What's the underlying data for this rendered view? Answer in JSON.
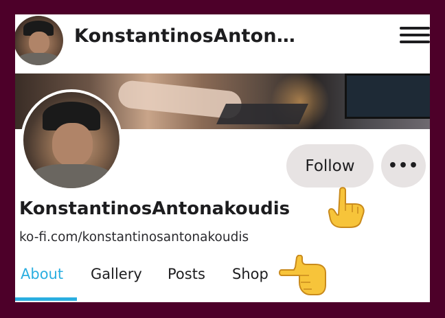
{
  "header": {
    "title": "KonstantinosAnton…",
    "menu_icon": "hamburger-menu-icon"
  },
  "profile": {
    "name": "KonstantinosAntonakoudis",
    "url": "ko-fi.com/konstantinosantonakoudis"
  },
  "actions": {
    "follow_label": "Follow",
    "more_label": "•••"
  },
  "tabs": [
    {
      "label": "About",
      "active": true
    },
    {
      "label": "Gallery",
      "active": false
    },
    {
      "label": "Posts",
      "active": false
    },
    {
      "label": "Shop",
      "active": false
    }
  ],
  "colors": {
    "frame": "#4d0029",
    "accent": "#2aaee0",
    "button_bg": "#e7e3e3"
  },
  "annotations": {
    "pointer_up": "pointing-up-emoji",
    "pointer_right": "pointing-right-emoji"
  }
}
